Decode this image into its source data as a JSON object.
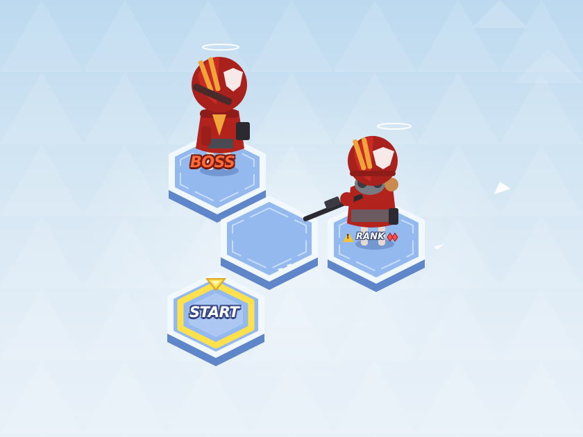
{
  "board": {
    "tiles": [
      {
        "id": "boss",
        "label": "BOSS"
      },
      {
        "id": "middle",
        "label": ""
      },
      {
        "id": "rank",
        "label": "RANK"
      },
      {
        "id": "start",
        "label": "START"
      }
    ]
  },
  "colors": {
    "tile_fill": "#93b9ee",
    "tile_border": "#f2f8ff",
    "tile_side": "#5e86c9",
    "start_ring": "#ffe04d",
    "boss_text": "#ff6a3a",
    "enemy_red": "#b3231e",
    "enemy_stripe": "#f0a43a"
  },
  "icons": {
    "start_marker": "down-triangle-marker-icon",
    "rank_warning": "warning-icon",
    "rank_diamonds": "diamond-icon",
    "enemy": "red-helmet-soldier-icon",
    "halo": "halo-ring-icon"
  }
}
